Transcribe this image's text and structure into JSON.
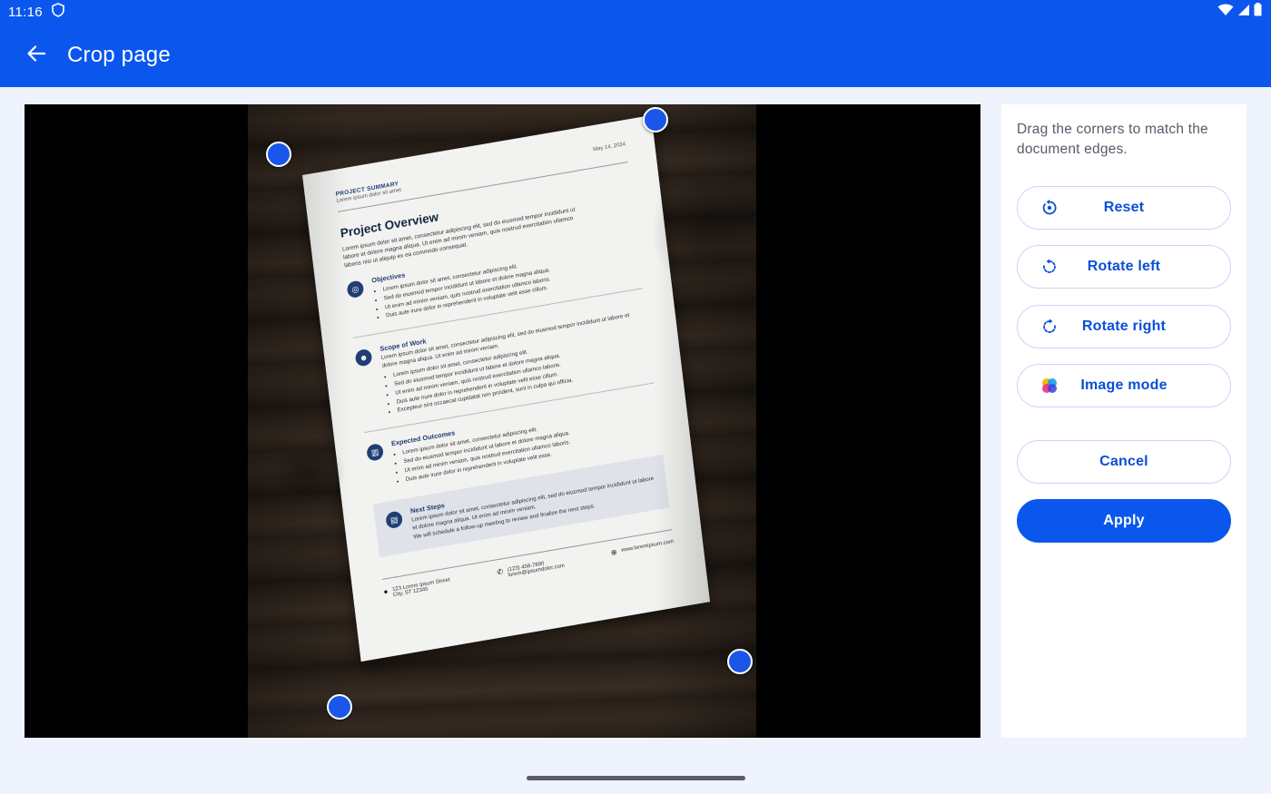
{
  "status_bar": {
    "time": "11:16"
  },
  "app_bar": {
    "title": "Crop page",
    "back_icon": "arrow-back-icon"
  },
  "document": {
    "kicker": "PROJECT SUMMARY",
    "kicker_sub": "Lorem ipsum dolor sit amet",
    "date": "May 14, 2024",
    "title": "Project Overview",
    "intro": "Lorem ipsum dolor sit amet, consectetur adipiscing elit, sed do eiusmod tempor incididunt ut labore et dolore magna aliqua. Ut enim ad minim veniam, quis nostrud exercitation ullamco laboris nisi ut aliquip ex ea commodo consequat.",
    "sections": {
      "objectives": {
        "title": "Objectives",
        "items": [
          "Lorem ipsum dolor sit amet, consectetur adipiscing elit.",
          "Sed do eiusmod tempor incididunt ut labore et dolore magna aliqua.",
          "Ut enim ad minim veniam, quis nostrud exercitation ullamco laboris.",
          "Duis aute irure dolor in reprehenderit in voluptate velit esse cillum."
        ]
      },
      "scope": {
        "title": "Scope of Work",
        "lead": "Lorem ipsum dolor sit amet, consectetur adipiscing elit, sed do eiusmod tempor incididunt ut labore et dolore magna aliqua. Ut enim ad minim veniam.",
        "items": [
          "Lorem ipsum dolor sit amet, consectetur adipiscing elit.",
          "Sed do eiusmod tempor incididunt ut labore et dolore magna aliqua.",
          "Ut enim ad minim veniam, quis nostrud exercitation ullamco laboris.",
          "Duis aute irure dolor in reprehenderit in voluptate velit esse cillum.",
          "Excepteur sint occaecat cupidatat non proident, sunt in culpa qui officia."
        ]
      },
      "outcomes": {
        "title": "Expected Outcomes",
        "items": [
          "Lorem ipsum dolor sit amet, consectetur adipiscing elit.",
          "Sed do eiusmod tempor incididunt ut labore et dolore magna aliqua.",
          "Ut enim ad minim veniam, quis nostrud exercitation ullamco laboris.",
          "Duis aute irure dolor in reprehenderit in voluptate velit esse."
        ]
      },
      "next_steps": {
        "title": "Next Steps",
        "lead": "Lorem ipsum dolor sit amet, consectetur adipiscing elit, sed do eiusmod tempor incididunt ut labore et dolore magna aliqua. Ut enim ad minim veniam.",
        "tail": "We will schedule a follow-up meeting to review and finalize the next steps."
      }
    },
    "footer": {
      "address_line1": "123 Lorem Ipsum Street",
      "address_line2": "City, ST 12345",
      "phone": "(123) 456-7890",
      "email": "lorem@ipsumdolor.com",
      "web": "www.loremipsum.com"
    }
  },
  "panel": {
    "instructions": "Drag the corners to match the document edges.",
    "buttons": {
      "reset": {
        "label": "Reset",
        "icon": "reset-icon"
      },
      "rotate_left": {
        "label": "Rotate left",
        "icon": "rotate-left-icon"
      },
      "rotate_right": {
        "label": "Rotate right",
        "icon": "rotate-right-icon"
      },
      "image_mode": {
        "label": "Image mode",
        "icon": "color-palette-icon"
      },
      "cancel": {
        "label": "Cancel"
      },
      "apply": {
        "label": "Apply"
      }
    }
  },
  "colors": {
    "primary": "#0b57ee",
    "handle": "#1a56e8",
    "background": "#eef3fe"
  }
}
